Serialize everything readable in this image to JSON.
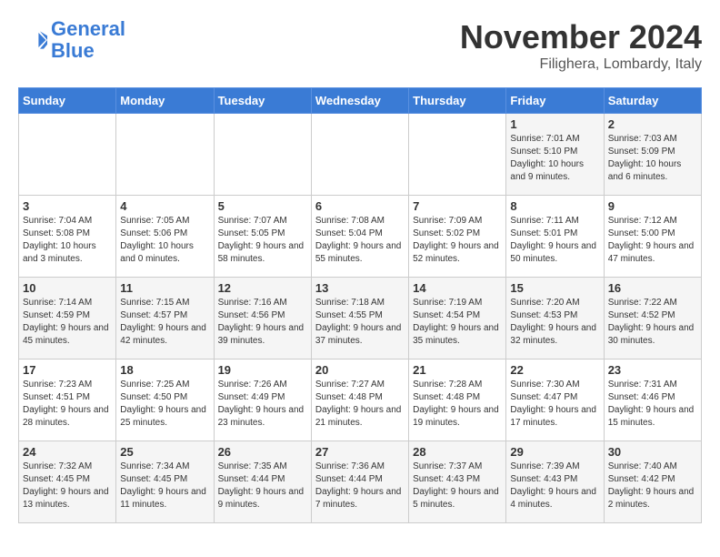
{
  "header": {
    "logo_general": "General",
    "logo_blue": "Blue",
    "month": "November 2024",
    "location": "Filighera, Lombardy, Italy"
  },
  "weekdays": [
    "Sunday",
    "Monday",
    "Tuesday",
    "Wednesday",
    "Thursday",
    "Friday",
    "Saturday"
  ],
  "weeks": [
    [
      {
        "day": "",
        "info": ""
      },
      {
        "day": "",
        "info": ""
      },
      {
        "day": "",
        "info": ""
      },
      {
        "day": "",
        "info": ""
      },
      {
        "day": "",
        "info": ""
      },
      {
        "day": "1",
        "info": "Sunrise: 7:01 AM\nSunset: 5:10 PM\nDaylight: 10 hours and 9 minutes."
      },
      {
        "day": "2",
        "info": "Sunrise: 7:03 AM\nSunset: 5:09 PM\nDaylight: 10 hours and 6 minutes."
      }
    ],
    [
      {
        "day": "3",
        "info": "Sunrise: 7:04 AM\nSunset: 5:08 PM\nDaylight: 10 hours and 3 minutes."
      },
      {
        "day": "4",
        "info": "Sunrise: 7:05 AM\nSunset: 5:06 PM\nDaylight: 10 hours and 0 minutes."
      },
      {
        "day": "5",
        "info": "Sunrise: 7:07 AM\nSunset: 5:05 PM\nDaylight: 9 hours and 58 minutes."
      },
      {
        "day": "6",
        "info": "Sunrise: 7:08 AM\nSunset: 5:04 PM\nDaylight: 9 hours and 55 minutes."
      },
      {
        "day": "7",
        "info": "Sunrise: 7:09 AM\nSunset: 5:02 PM\nDaylight: 9 hours and 52 minutes."
      },
      {
        "day": "8",
        "info": "Sunrise: 7:11 AM\nSunset: 5:01 PM\nDaylight: 9 hours and 50 minutes."
      },
      {
        "day": "9",
        "info": "Sunrise: 7:12 AM\nSunset: 5:00 PM\nDaylight: 9 hours and 47 minutes."
      }
    ],
    [
      {
        "day": "10",
        "info": "Sunrise: 7:14 AM\nSunset: 4:59 PM\nDaylight: 9 hours and 45 minutes."
      },
      {
        "day": "11",
        "info": "Sunrise: 7:15 AM\nSunset: 4:57 PM\nDaylight: 9 hours and 42 minutes."
      },
      {
        "day": "12",
        "info": "Sunrise: 7:16 AM\nSunset: 4:56 PM\nDaylight: 9 hours and 39 minutes."
      },
      {
        "day": "13",
        "info": "Sunrise: 7:18 AM\nSunset: 4:55 PM\nDaylight: 9 hours and 37 minutes."
      },
      {
        "day": "14",
        "info": "Sunrise: 7:19 AM\nSunset: 4:54 PM\nDaylight: 9 hours and 35 minutes."
      },
      {
        "day": "15",
        "info": "Sunrise: 7:20 AM\nSunset: 4:53 PM\nDaylight: 9 hours and 32 minutes."
      },
      {
        "day": "16",
        "info": "Sunrise: 7:22 AM\nSunset: 4:52 PM\nDaylight: 9 hours and 30 minutes."
      }
    ],
    [
      {
        "day": "17",
        "info": "Sunrise: 7:23 AM\nSunset: 4:51 PM\nDaylight: 9 hours and 28 minutes."
      },
      {
        "day": "18",
        "info": "Sunrise: 7:25 AM\nSunset: 4:50 PM\nDaylight: 9 hours and 25 minutes."
      },
      {
        "day": "19",
        "info": "Sunrise: 7:26 AM\nSunset: 4:49 PM\nDaylight: 9 hours and 23 minutes."
      },
      {
        "day": "20",
        "info": "Sunrise: 7:27 AM\nSunset: 4:48 PM\nDaylight: 9 hours and 21 minutes."
      },
      {
        "day": "21",
        "info": "Sunrise: 7:28 AM\nSunset: 4:48 PM\nDaylight: 9 hours and 19 minutes."
      },
      {
        "day": "22",
        "info": "Sunrise: 7:30 AM\nSunset: 4:47 PM\nDaylight: 9 hours and 17 minutes."
      },
      {
        "day": "23",
        "info": "Sunrise: 7:31 AM\nSunset: 4:46 PM\nDaylight: 9 hours and 15 minutes."
      }
    ],
    [
      {
        "day": "24",
        "info": "Sunrise: 7:32 AM\nSunset: 4:45 PM\nDaylight: 9 hours and 13 minutes."
      },
      {
        "day": "25",
        "info": "Sunrise: 7:34 AM\nSunset: 4:45 PM\nDaylight: 9 hours and 11 minutes."
      },
      {
        "day": "26",
        "info": "Sunrise: 7:35 AM\nSunset: 4:44 PM\nDaylight: 9 hours and 9 minutes."
      },
      {
        "day": "27",
        "info": "Sunrise: 7:36 AM\nSunset: 4:44 PM\nDaylight: 9 hours and 7 minutes."
      },
      {
        "day": "28",
        "info": "Sunrise: 7:37 AM\nSunset: 4:43 PM\nDaylight: 9 hours and 5 minutes."
      },
      {
        "day": "29",
        "info": "Sunrise: 7:39 AM\nSunset: 4:43 PM\nDaylight: 9 hours and 4 minutes."
      },
      {
        "day": "30",
        "info": "Sunrise: 7:40 AM\nSunset: 4:42 PM\nDaylight: 9 hours and 2 minutes."
      }
    ]
  ]
}
